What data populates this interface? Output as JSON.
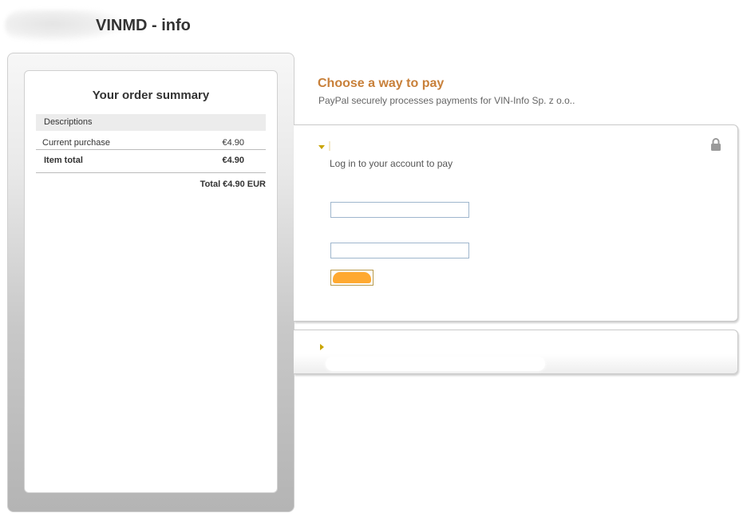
{
  "header": {
    "merchant_name": "VINMD - info"
  },
  "order_summary": {
    "title": "Your order summary",
    "descriptions_header": "Descriptions",
    "items": [
      {
        "label": "Current purchase",
        "amount": "€4.90"
      }
    ],
    "item_total_label": "Item total",
    "item_total_amount": "€4.90",
    "total": "Total €4.90 EUR"
  },
  "payment": {
    "heading": "Choose a way to pay",
    "subheading": "PayPal securely processes payments for VIN-Info Sp. z o.o..",
    "login_panel": {
      "prompt": "Log in to your account to pay",
      "email_value": "",
      "password_value": "",
      "lock_icon": "lock-icon",
      "expanded": true
    },
    "guest_panel": {
      "expanded": false
    }
  },
  "colors": {
    "heading": "#c8803a",
    "accent_triangle": "#c9a400",
    "login_button": "#ffa930",
    "field_border": "#9fb6cd"
  }
}
